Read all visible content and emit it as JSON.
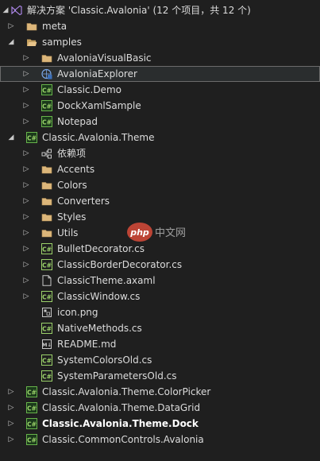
{
  "solution": {
    "title": "解决方案 'Classic.Avalonia' (12 个项目，共 12 个)"
  },
  "tree": {
    "meta": "meta",
    "samples": "samples",
    "avalonia_visual_basic": "AvaloniaVisualBasic",
    "avalonia_explorer": "AvaloniaExplorer",
    "classic_demo": "Classic.Demo",
    "dock_xaml_sample": "DockXamlSample",
    "notepad": "Notepad",
    "theme_project": "Classic.Avalonia.Theme",
    "dependencies": "依赖项",
    "accents": "Accents",
    "colors": "Colors",
    "converters": "Converters",
    "styles": "Styles",
    "utils": "Utils",
    "bullet_decorator": "BulletDecorator.cs",
    "classic_border_decorator": "ClassicBorderDecorator.cs",
    "classic_theme": "ClassicTheme.axaml",
    "classic_window": "ClassicWindow.cs",
    "icon_png": "icon.png",
    "native_methods": "NativeMethods.cs",
    "readme": "README.md",
    "system_colors_old": "SystemColorsOld.cs",
    "system_parameters_old": "SystemParametersOld.cs",
    "color_picker_project": "Classic.Avalonia.Theme.ColorPicker",
    "data_grid_project": "Classic.Avalonia.Theme.DataGrid",
    "dock_project": "Classic.Avalonia.Theme.Dock",
    "common_controls_project": "Classic.CommonControls.Avalonia"
  },
  "watermark": {
    "logo_text": "php",
    "site_text": "中文网"
  },
  "colors": {
    "background": "#1f1f1f",
    "text": "#dcdcdc",
    "folder": "#dcb67a",
    "csharp": "#9bd16a",
    "project_box": "#68b34b",
    "selection_border": "#6b6b6b",
    "solution_icon": "#b48cf2"
  }
}
